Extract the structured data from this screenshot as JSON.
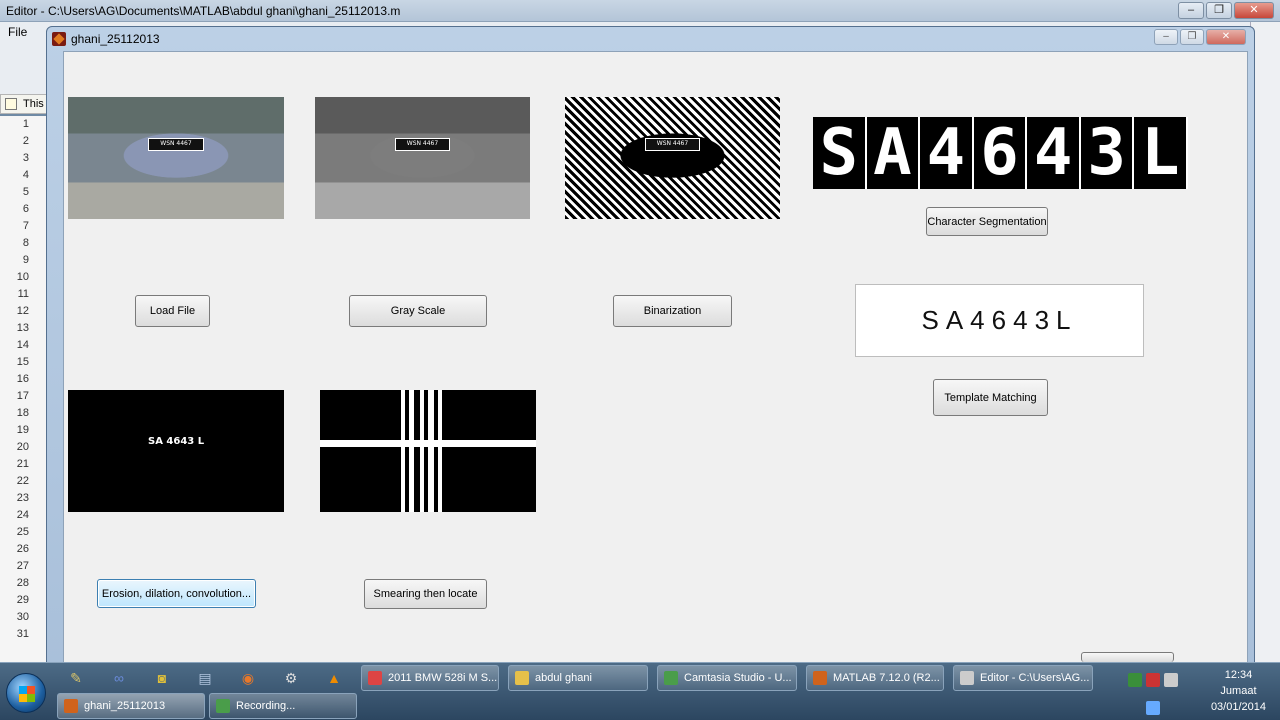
{
  "editor": {
    "title": "Editor - C:\\Users\\AG\\Documents\\MATLAB\\abdul ghani\\ghani_25112013.m",
    "menu_file": "File",
    "tab_label": "This",
    "line_numbers": [
      "1",
      "2",
      "3",
      "4",
      "5",
      "6",
      "7",
      "8",
      "9",
      "10",
      "11",
      "12",
      "13",
      "14",
      "15",
      "16",
      "17",
      "18",
      "19",
      "20",
      "21",
      "22",
      "23",
      "24",
      "25",
      "26",
      "27",
      "28",
      "29",
      "30",
      "31"
    ],
    "win_minimize": "–",
    "win_maximize": "❐",
    "win_close": "✕"
  },
  "figure": {
    "title": "ghani_25112013",
    "buttons": {
      "load_file": "Load File",
      "gray_scale": "Gray Scale",
      "binarization": "Binarization",
      "character_segmentation": "Character Segmentation",
      "template_matching": "Template Matching",
      "erosion": "Erosion, dilation, convolution...",
      "smearing": "Smearing then locate"
    },
    "plate_small": "WSN 4467",
    "segmented_chars": [
      "S",
      "A",
      "4",
      "6",
      "4",
      "3",
      "L"
    ],
    "recognized_text": "SA4643L",
    "eroded_label": "SA 4643 L"
  },
  "taskbar": {
    "quicklaunch": [
      "pen-icon",
      "link-icon",
      "camera-icon",
      "note-icon",
      "firefox-icon",
      "tool-icon",
      "vlc-icon"
    ],
    "tasks_row1": [
      {
        "label": "2011 BMW 528i M S...",
        "icon": "chrome-icon"
      },
      {
        "label": "abdul ghani",
        "icon": "folder-icon"
      },
      {
        "label": "Camtasia Studio - U...",
        "icon": "camtasia-icon"
      },
      {
        "label": "MATLAB  7.12.0 (R2...",
        "icon": "matlab-icon"
      },
      {
        "label": "Editor - C:\\Users\\AG...",
        "icon": "editor-icon"
      }
    ],
    "tasks_row2": [
      {
        "label": "ghani_25112013",
        "icon": "matlab-figure-icon"
      },
      {
        "label": "Recording...",
        "icon": "recording-icon"
      }
    ],
    "clock_time": "12:34",
    "clock_day": "Jumaat",
    "clock_date": "03/01/2014"
  },
  "colors": {
    "taskbar": "#2c4660",
    "button_focus": "#bee6fd",
    "matlab_logo": "#e07a20"
  }
}
